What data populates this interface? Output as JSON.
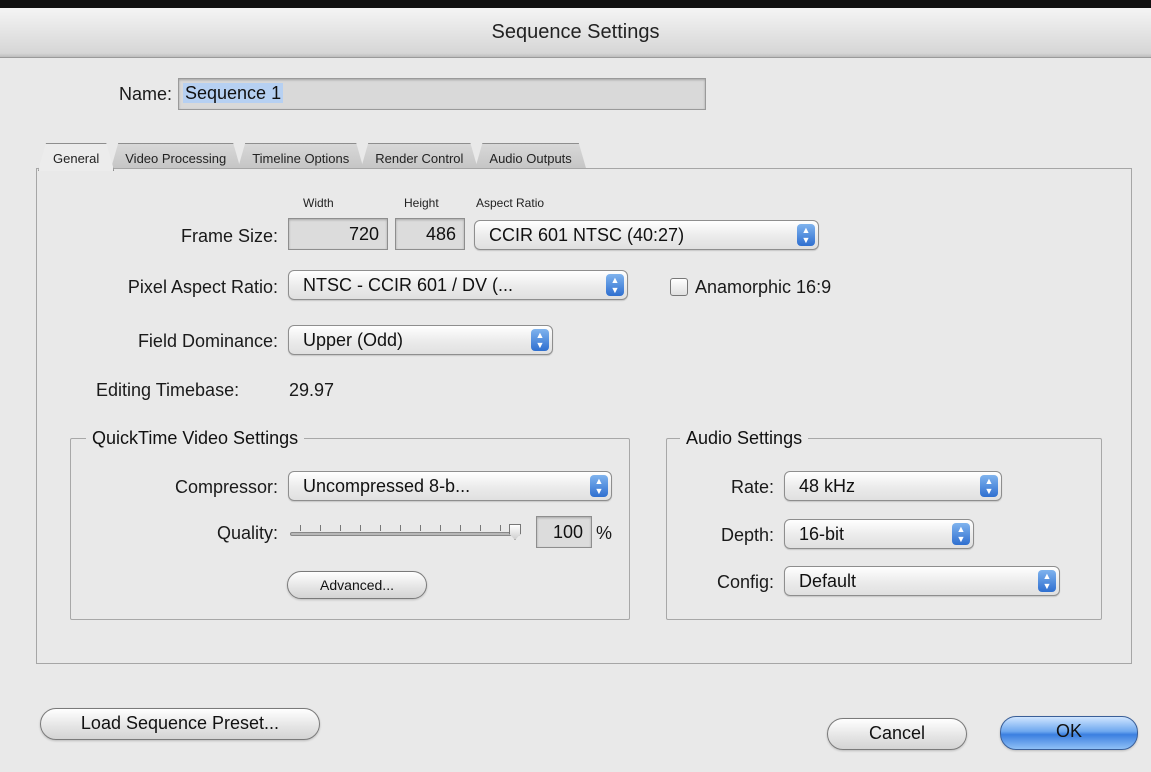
{
  "window": {
    "title": "Sequence Settings"
  },
  "name": {
    "label": "Name:",
    "value": "Sequence 1"
  },
  "tabs": [
    "General",
    "Video Processing",
    "Timeline Options",
    "Render Control",
    "Audio Outputs"
  ],
  "general": {
    "frame_size": {
      "label": "Frame Size:",
      "width_header": "Width",
      "height_header": "Height",
      "aspect_header": "Aspect Ratio",
      "width": "720",
      "separator": "x",
      "height": "486",
      "aspect_ratio": "CCIR 601 NTSC (40:27)"
    },
    "pixel_aspect": {
      "label": "Pixel Aspect Ratio:",
      "value": "NTSC - CCIR 601 / DV (..."
    },
    "anamorphic": {
      "label": "Anamorphic 16:9",
      "checked": false
    },
    "field_dominance": {
      "label": "Field Dominance:",
      "value": "Upper (Odd)"
    },
    "editing_timebase": {
      "label": "Editing Timebase:",
      "value": "29.97"
    },
    "qt_video": {
      "title": "QuickTime Video Settings",
      "compressor_label": "Compressor:",
      "compressor_value": "Uncompressed 8-b...",
      "quality_label": "Quality:",
      "quality_value": "100",
      "quality_unit": "%",
      "advanced_button": "Advanced..."
    },
    "audio": {
      "title": "Audio Settings",
      "rate_label": "Rate:",
      "rate_value": "48 kHz",
      "depth_label": "Depth:",
      "depth_value": "16-bit",
      "config_label": "Config:",
      "config_value": "Default"
    }
  },
  "buttons": {
    "load_preset": "Load Sequence Preset...",
    "cancel": "Cancel",
    "ok": "OK"
  },
  "icons": {
    "popup": "updown-arrows-icon",
    "slider": "slider-thumb-icon"
  },
  "colors": {
    "accent": "#3b7fe0",
    "selection": "#b6d0f2"
  }
}
